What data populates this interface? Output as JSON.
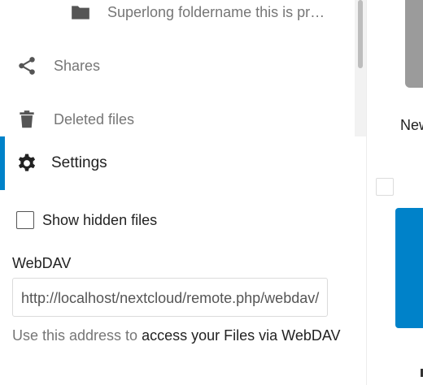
{
  "navigation": {
    "folder_item": {
      "label": "Superlong foldername this is pr…",
      "icon": "folder-icon"
    },
    "shares": {
      "label": "Shares",
      "icon": "share-icon"
    },
    "deleted": {
      "label": "Deleted files",
      "icon": "trash-icon"
    }
  },
  "settings": {
    "label": "Settings",
    "icon": "gear-icon",
    "accent_color": "#0082c9",
    "show_hidden": {
      "label": "Show hidden files",
      "checked": false
    },
    "webdav": {
      "title": "WebDAV",
      "url": "http://localhost/nextcloud/remote.php/webdav/",
      "hint_prefix": "Use this address to",
      "hint_link": "access your Files via WebDAV"
    }
  },
  "right_pane": {
    "new_label": "New"
  },
  "colors": {
    "primary": "#0082c9",
    "text_muted": "#767676",
    "text_main": "#222222"
  }
}
